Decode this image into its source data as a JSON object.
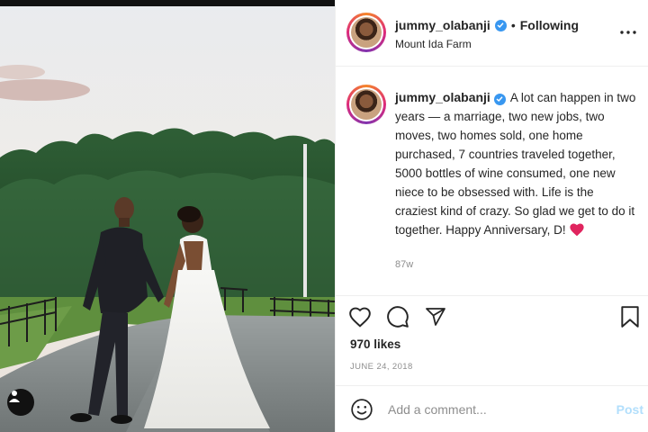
{
  "post": {
    "author": "jummy_olabanji",
    "follow_status": "Following",
    "separator": "•",
    "location": "Mount Ida Farm",
    "more_icon": "more-options-icon",
    "verified_icon": "verified-badge-icon"
  },
  "caption": {
    "username": "jummy_olabanji",
    "text": "A lot can happen in two years — a marriage, two new jobs, two moves, two homes sold, one home purchased, 7 countries traveled together, 5000 bottles of wine consumed, one new niece to be obsessed with. Life is the craziest kind of crazy. So glad we get to do it together. Happy Anniversary, D!",
    "timestamp": "87w"
  },
  "actions": {
    "icons": [
      "heart-outline-icon",
      "comment-icon",
      "share-icon",
      "bookmark-icon"
    ],
    "likes": "970 likes",
    "date": "JUNE 24, 2018"
  },
  "comment": {
    "placeholder": "Add a comment...",
    "post_label": "Post",
    "emoji_icon": "emoji-icon"
  },
  "colors": {
    "text": "#262626",
    "muted": "#8e8e8e",
    "link_blue_disabled": "#b2dffc",
    "verified_blue": "#3897f0",
    "heart_red": "#e0245e"
  }
}
